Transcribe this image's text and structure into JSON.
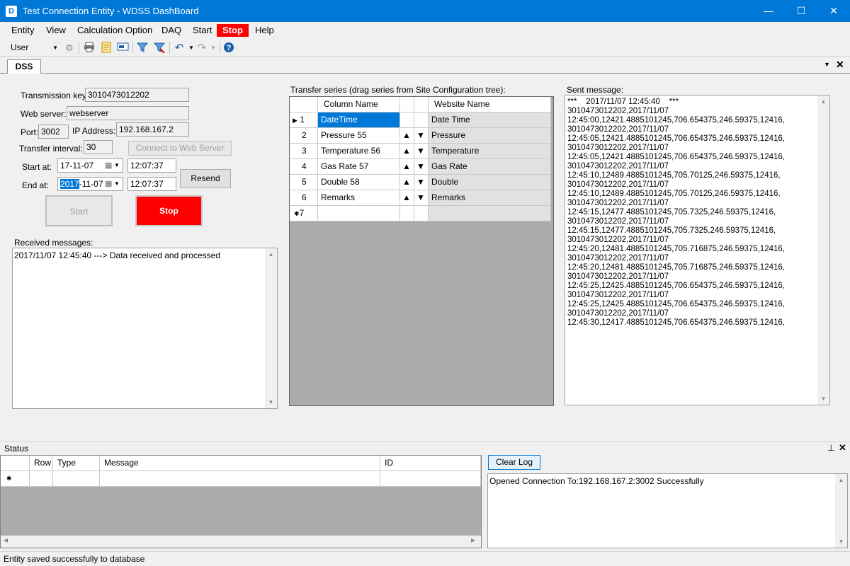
{
  "window": {
    "app_icon": "D",
    "title": "Test Connection Entity - WDSS DashBoard",
    "minimize": "—",
    "maximize": "☐",
    "close": "✕"
  },
  "menu": {
    "entity": "Entity",
    "view": "View",
    "calculation_option": "Calculation Option",
    "daq": "DAQ",
    "start": "Start",
    "stop": "Stop",
    "help": "Help"
  },
  "toolbar": {
    "user_select": "User",
    "icons": [
      "gear-icon",
      "printer-icon",
      "report-icon",
      "screen-icon",
      "filter-icon",
      "filter-clear-icon",
      "undo-icon",
      "redo-icon",
      "help-icon"
    ]
  },
  "tabs": {
    "dss": "DSS"
  },
  "form": {
    "transmission_key_label": "Transmission key:",
    "transmission_key_value": "3010473012202",
    "web_server_label": "Web server:",
    "web_server_value": "webserver",
    "port_label": "Port:",
    "port_value": "3002",
    "ip_label": "IP Address:",
    "ip_value": "192.168.167.2",
    "transfer_interval_label": "Transfer interval:",
    "transfer_interval_value": "30",
    "connect_button": "Connect to Web Server",
    "start_at_label": "Start at:",
    "start_date": "17-11-07",
    "start_time": "12:07:37",
    "end_at_label": "End at:",
    "end_date_selected": "2017",
    "end_date_rest": "-11-07",
    "end_time": "12:07:37",
    "resend_button": "Resend",
    "start_button": "Start",
    "stop_button": "Stop",
    "stop_color": "#ff0000"
  },
  "received": {
    "label": "Received messages:",
    "lines": [
      "2017/11/07 12:45:40 ---> Data received and processed"
    ]
  },
  "transfer": {
    "label": "Transfer series (drag series from Site Configuration tree):",
    "columns": [
      "Column Name",
      "Website Name"
    ],
    "rows": [
      {
        "num": "1",
        "column": "DateTime",
        "website": "Date Time",
        "arrows": false
      },
      {
        "num": "2",
        "column": "Pressure 55",
        "website": "Pressure",
        "arrows": true
      },
      {
        "num": "3",
        "column": "Temperature 56",
        "website": "Temperature",
        "arrows": true
      },
      {
        "num": "4",
        "column": "Gas Rate 57",
        "website": "Gas Rate",
        "arrows": true
      },
      {
        "num": "5",
        "column": "Double 58",
        "website": "Double",
        "arrows": true
      },
      {
        "num": "6",
        "column": "Remarks",
        "website": "Remarks",
        "arrows": true
      }
    ],
    "new_row_num": "7",
    "up_arrow": "▲",
    "down_arrow": "▼"
  },
  "sent": {
    "label": "Sent message:",
    "lines": [
      "***    2017/11/07 12:45:40    ***",
      "3010473012202,2017/11/07",
      "12:45:00,12421.4885101245,706.654375,246.59375,12416,",
      "3010473012202,2017/11/07",
      "12:45:05,12421.4885101245,706.654375,246.59375,12416,",
      "3010473012202,2017/11/07",
      "12:45:05,12421.4885101245,706.654375,246.59375,12416,",
      "3010473012202,2017/11/07",
      "12:45:10,12489.4885101245,705.70125,246.59375,12416,",
      "3010473012202,2017/11/07",
      "12:45:10,12489.4885101245,705.70125,246.59375,12416,",
      "3010473012202,2017/11/07",
      "12:45:15,12477.4885101245,705.7325,246.59375,12416,",
      "3010473012202,2017/11/07",
      "12:45:15,12477.4885101245,705.7325,246.59375,12416,",
      "3010473012202,2017/11/07",
      "12:45:20,12481.4885101245,705.716875,246.59375,12416,",
      "3010473012202,2017/11/07",
      "12:45:20,12481.4885101245,705.716875,246.59375,12416,",
      "3010473012202,2017/11/07",
      "12:45:25,12425.4885101245,706.654375,246.59375,12416,",
      "3010473012202,2017/11/07",
      "12:45:25,12425.4885101245,706.654375,246.59375,12416,",
      "3010473012202,2017/11/07",
      "12:45:30,12417.4885101245,706.654375,246.59375,12416,"
    ]
  },
  "status": {
    "title": "Status",
    "columns": [
      "Row",
      "Type",
      "Message",
      "ID"
    ],
    "clear_log": "Clear Log",
    "log_lines": [
      "Opened Connection To:192.168.167.2:3002 Successfully"
    ]
  },
  "statusbar": {
    "text": "Entity saved successfully to database"
  }
}
